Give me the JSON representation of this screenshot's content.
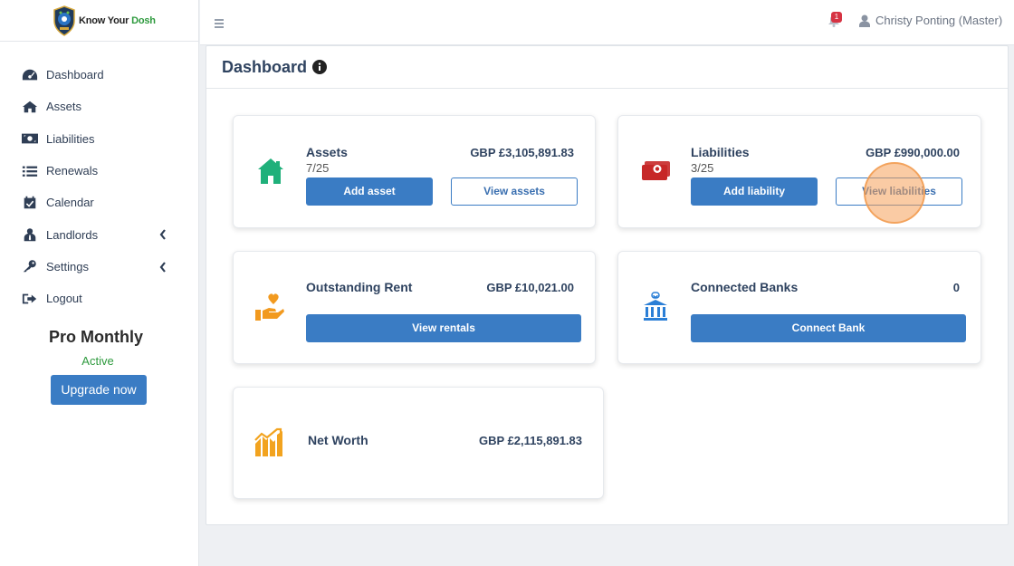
{
  "brand": {
    "name_prefix": "Know Your ",
    "name_highlight": "Dosh"
  },
  "sidebar": {
    "items": [
      {
        "label": "Dashboard",
        "icon": "tachometer-icon"
      },
      {
        "label": "Assets",
        "icon": "home-icon"
      },
      {
        "label": "Liabilities",
        "icon": "money-bill-icon"
      },
      {
        "label": "Renewals",
        "icon": "list-icon"
      },
      {
        "label": "Calendar",
        "icon": "calendar-check-icon"
      },
      {
        "label": "Landlords",
        "icon": "user-tie-icon",
        "expandable": true
      },
      {
        "label": "Settings",
        "icon": "key-icon",
        "expandable": true
      },
      {
        "label": "Logout",
        "icon": "sign-out-icon"
      }
    ],
    "plan": {
      "name": "Pro Monthly",
      "status": "Active",
      "upgrade_label": "Upgrade now"
    }
  },
  "topbar": {
    "notification_count": "1",
    "user_name": "Christy Ponting (Master)"
  },
  "page": {
    "title": "Dashboard"
  },
  "cards": {
    "assets": {
      "title": "Assets",
      "value": "GBP £3,105,891.83",
      "count": "7/25",
      "primary_label": "Add asset",
      "secondary_label": "View assets"
    },
    "liabilities": {
      "title": "Liabilities",
      "value": "GBP £990,000.00",
      "count": "3/25",
      "primary_label": "Add liability",
      "secondary_label": "View liabilities"
    },
    "rent": {
      "title": "Outstanding Rent",
      "value": "GBP £10,021.00",
      "primary_label": "View rentals"
    },
    "banks": {
      "title": "Connected Banks",
      "value": "0",
      "primary_label": "Connect Bank"
    },
    "networth": {
      "title": "Net Worth",
      "value": "GBP £2,115,891.83"
    }
  },
  "colors": {
    "primary": "#3a7cc4",
    "sidebar_text": "#2f3e55",
    "active_green": "#2e9a3e",
    "assets_icon": "#1fb07a",
    "liabilities_icon": "#c62828",
    "rent_icon": "#f29a1f",
    "banks_icon": "#2b7fd6",
    "networth_icon": "#f2a31f",
    "badge": "#d63343"
  }
}
